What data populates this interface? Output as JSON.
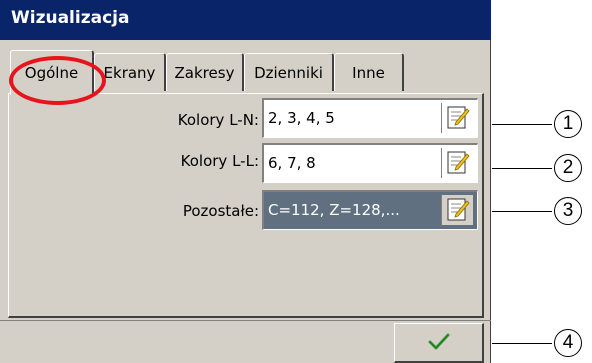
{
  "window": {
    "title": "Wizualizacja"
  },
  "tabs": [
    {
      "label": "Ogólne"
    },
    {
      "label": "Ekrany"
    },
    {
      "label": "Zakresy"
    },
    {
      "label": "Dzienniki"
    },
    {
      "label": "Inne"
    }
  ],
  "active_tab": "Ogólne",
  "fields": [
    {
      "label": "Kolory L-N:",
      "value": "2, 3, 4, 5",
      "icon": "edit-icon",
      "selected": false
    },
    {
      "label": "Kolory L-L:",
      "value": "6, 7, 8",
      "icon": "edit-icon",
      "selected": false
    },
    {
      "label": "Pozostałe:",
      "value": "C=112, Z=128,...",
      "icon": "edit-icon",
      "selected": true
    }
  ],
  "ok_button": {
    "icon": "checkmark-icon"
  },
  "callouts": [
    "1",
    "2",
    "3",
    "4"
  ],
  "colors": {
    "title_bg": "#0a246a",
    "window_bg": "#d4d0c8",
    "selected_field_bg": "#617081",
    "highlight": "#e8141c",
    "check": "#3aa33a"
  }
}
